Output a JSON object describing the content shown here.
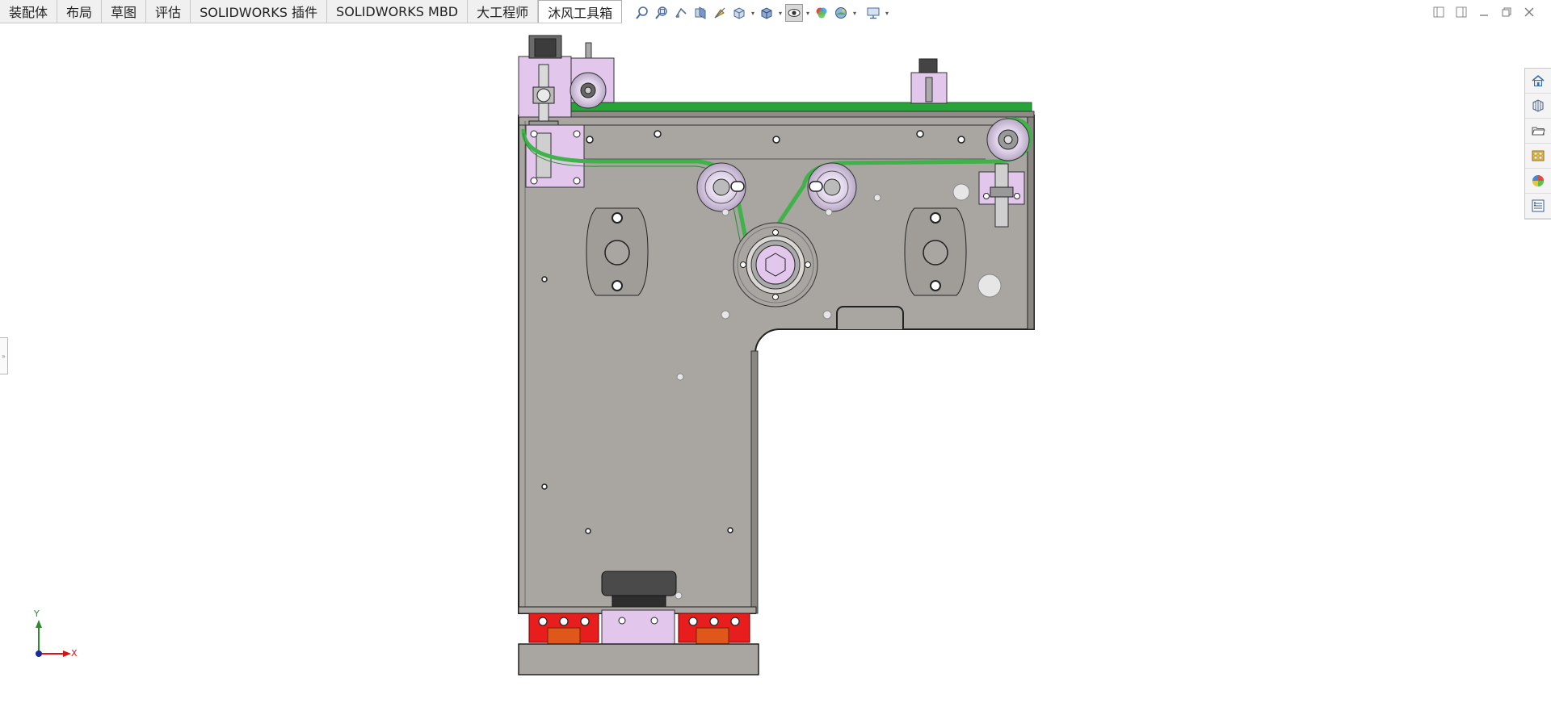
{
  "command_manager": {
    "tabs": [
      {
        "label": "装配体",
        "active": false
      },
      {
        "label": "布局",
        "active": false
      },
      {
        "label": "草图",
        "active": false
      },
      {
        "label": "评估",
        "active": false
      },
      {
        "label": "SOLIDWORKS 插件",
        "active": false
      },
      {
        "label": "SOLIDWORKS MBD",
        "active": false
      },
      {
        "label": "大工程师",
        "active": false
      },
      {
        "label": "沐风工具箱",
        "active": true
      }
    ]
  },
  "heads_up_toolbar": {
    "tools": [
      "zoom-to-fit-icon",
      "zoom-to-area-icon",
      "previous-view-icon",
      "section-view-icon",
      "dynamic-annotation-icon",
      "view-orientation-icon",
      "display-style-icon",
      "hide-show-items-icon",
      "edit-appearance-icon",
      "apply-scene-icon",
      "view-settings-icon"
    ]
  },
  "task_pane": {
    "items": [
      "home-icon",
      "design-library-icon",
      "file-explorer-icon",
      "view-palette-icon",
      "appearances-icon",
      "custom-properties-icon"
    ]
  },
  "triad": {
    "x_label": "X",
    "y_label": "Y"
  },
  "colors": {
    "plate": "#a9a6a1",
    "belt": "#3fb24a",
    "green_bar": "#27a33a",
    "purple_part": "#e2c6ec",
    "red_block": "#e81d1d",
    "orange_part": "#e0571c",
    "dark_knob": "#444444",
    "outline": "#222222"
  },
  "left_handle": {
    "glyph": "»"
  }
}
